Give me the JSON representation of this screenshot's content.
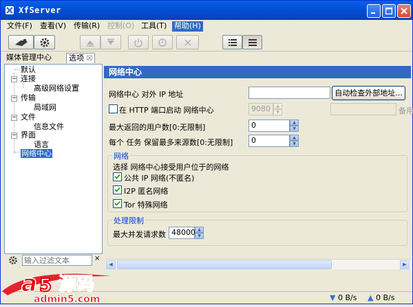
{
  "window": {
    "title": "XfServer",
    "min_label": "_",
    "max_label": "□",
    "close_label": "×"
  },
  "menu": [
    {
      "label": "文件(F)",
      "state": "normal"
    },
    {
      "label": "查看(V)",
      "state": "normal"
    },
    {
      "label": "传输(R)",
      "state": "normal"
    },
    {
      "label": "控制(O)",
      "state": "disabled"
    },
    {
      "label": "工具(T)",
      "state": "normal"
    },
    {
      "label": "帮助(H)",
      "state": "active"
    }
  ],
  "left_tabs": {
    "media": "媒体管理中心",
    "options": "选项",
    "options_close": "☒"
  },
  "tree": {
    "default": "默认",
    "connection": "连接",
    "advanced_network": "高级网络设置",
    "transfer": "传输",
    "lan": "局域网",
    "file": "文件",
    "info_file": "信息文件",
    "interface": "界面",
    "language": "语言",
    "network_center": "网络中心",
    "expander_minus": "−"
  },
  "filter": {
    "placeholder": "输入过滤文本",
    "clear": "×"
  },
  "panel": {
    "title": "网络中心",
    "external_ip_label": "网络中心 对外 IP 地址",
    "external_ip_value": "",
    "auto_check_button": "自动检查外部地址...",
    "http_start_label": "在 HTTP 端口启动 网络中心",
    "http_port_value": "9080",
    "backup_label": "备用",
    "max_users_label": "最大返回的用户数[0:无限制]",
    "max_users_value": "0",
    "max_sources_label": "每个 任务 保留最多来源数[0:无限制]",
    "max_sources_value": "0",
    "network_group_title": "网络",
    "network_desc": "选择 网络中心接受用户位于的网络",
    "networks": [
      {
        "label": "公共 IP 网络(不匿名)",
        "checked": true
      },
      {
        "label": "I2P 匿名网络",
        "checked": true
      },
      {
        "label": "Tor 特殊网络",
        "checked": true
      }
    ],
    "limits_group_title": "处理限制",
    "max_requests_label": "最大并发请求数",
    "max_requests_value": "48000"
  },
  "status": {
    "down_speed": "0 B/s",
    "up_speed": "0 B/s"
  },
  "watermark": {
    "logo_a": "a",
    "logo_5": "5",
    "logo_cn": "源码",
    "url": "admin5.com"
  },
  "colors": {
    "titlebar": "#0A5FE8",
    "selection": "#316AC5",
    "group_title": "#0046D5",
    "watermark_red": "#E60012"
  }
}
